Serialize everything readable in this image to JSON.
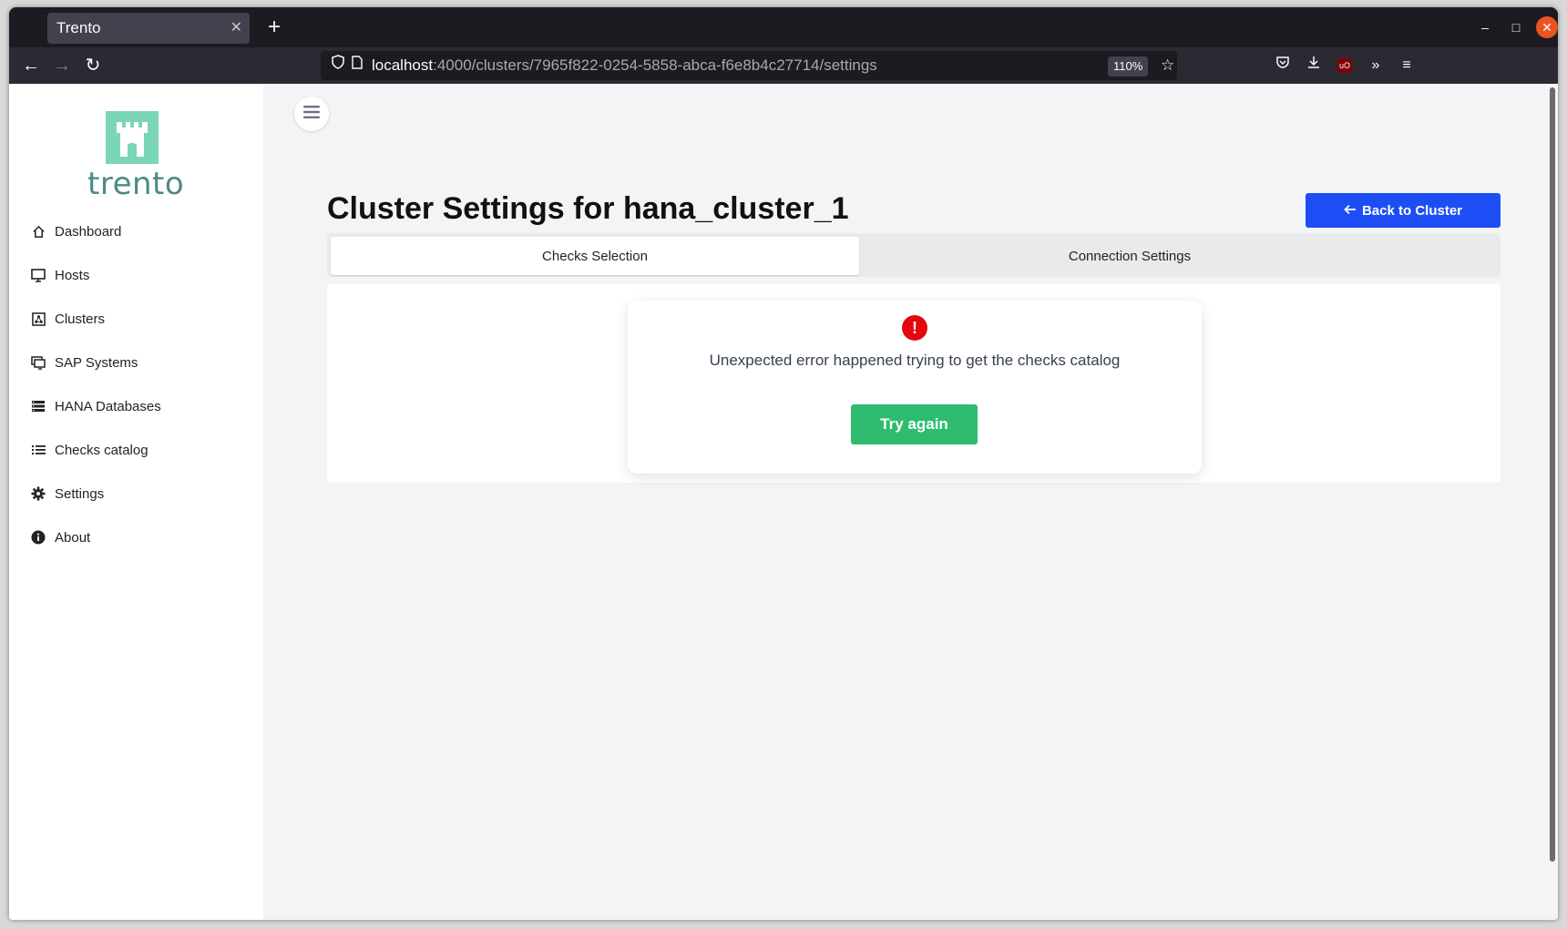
{
  "browser": {
    "tab_title": "Trento",
    "url_host": "localhost",
    "url_rest": ":4000/clusters/7965f822-0254-5858-abca-f6e8b4c27714/settings",
    "zoom": "110%"
  },
  "sidebar": {
    "logo_text": "trento",
    "items": [
      {
        "label": "Dashboard",
        "icon": "home-icon"
      },
      {
        "label": "Hosts",
        "icon": "monitor-icon"
      },
      {
        "label": "Clusters",
        "icon": "cluster-icon"
      },
      {
        "label": "SAP Systems",
        "icon": "screens-icon"
      },
      {
        "label": "HANA Databases",
        "icon": "database-icon"
      },
      {
        "label": "Checks catalog",
        "icon": "list-icon"
      },
      {
        "label": "Settings",
        "icon": "gear-icon"
      },
      {
        "label": "About",
        "icon": "info-icon"
      }
    ]
  },
  "page": {
    "title_prefix": "Cluster Settings for",
    "cluster_name": "hana_cluster_1",
    "back_button": "Back to Cluster",
    "tabs": [
      {
        "label": "Checks Selection",
        "active": true
      },
      {
        "label": "Connection Settings",
        "active": false
      }
    ],
    "error": {
      "message": "Unexpected error happened trying to get the checks catalog",
      "retry_label": "Try again"
    }
  },
  "colors": {
    "primary_blue": "#1d4ef5",
    "success_green": "#2ebd70",
    "error_red": "#e4070f",
    "logo_green": "#7bd6b5"
  }
}
